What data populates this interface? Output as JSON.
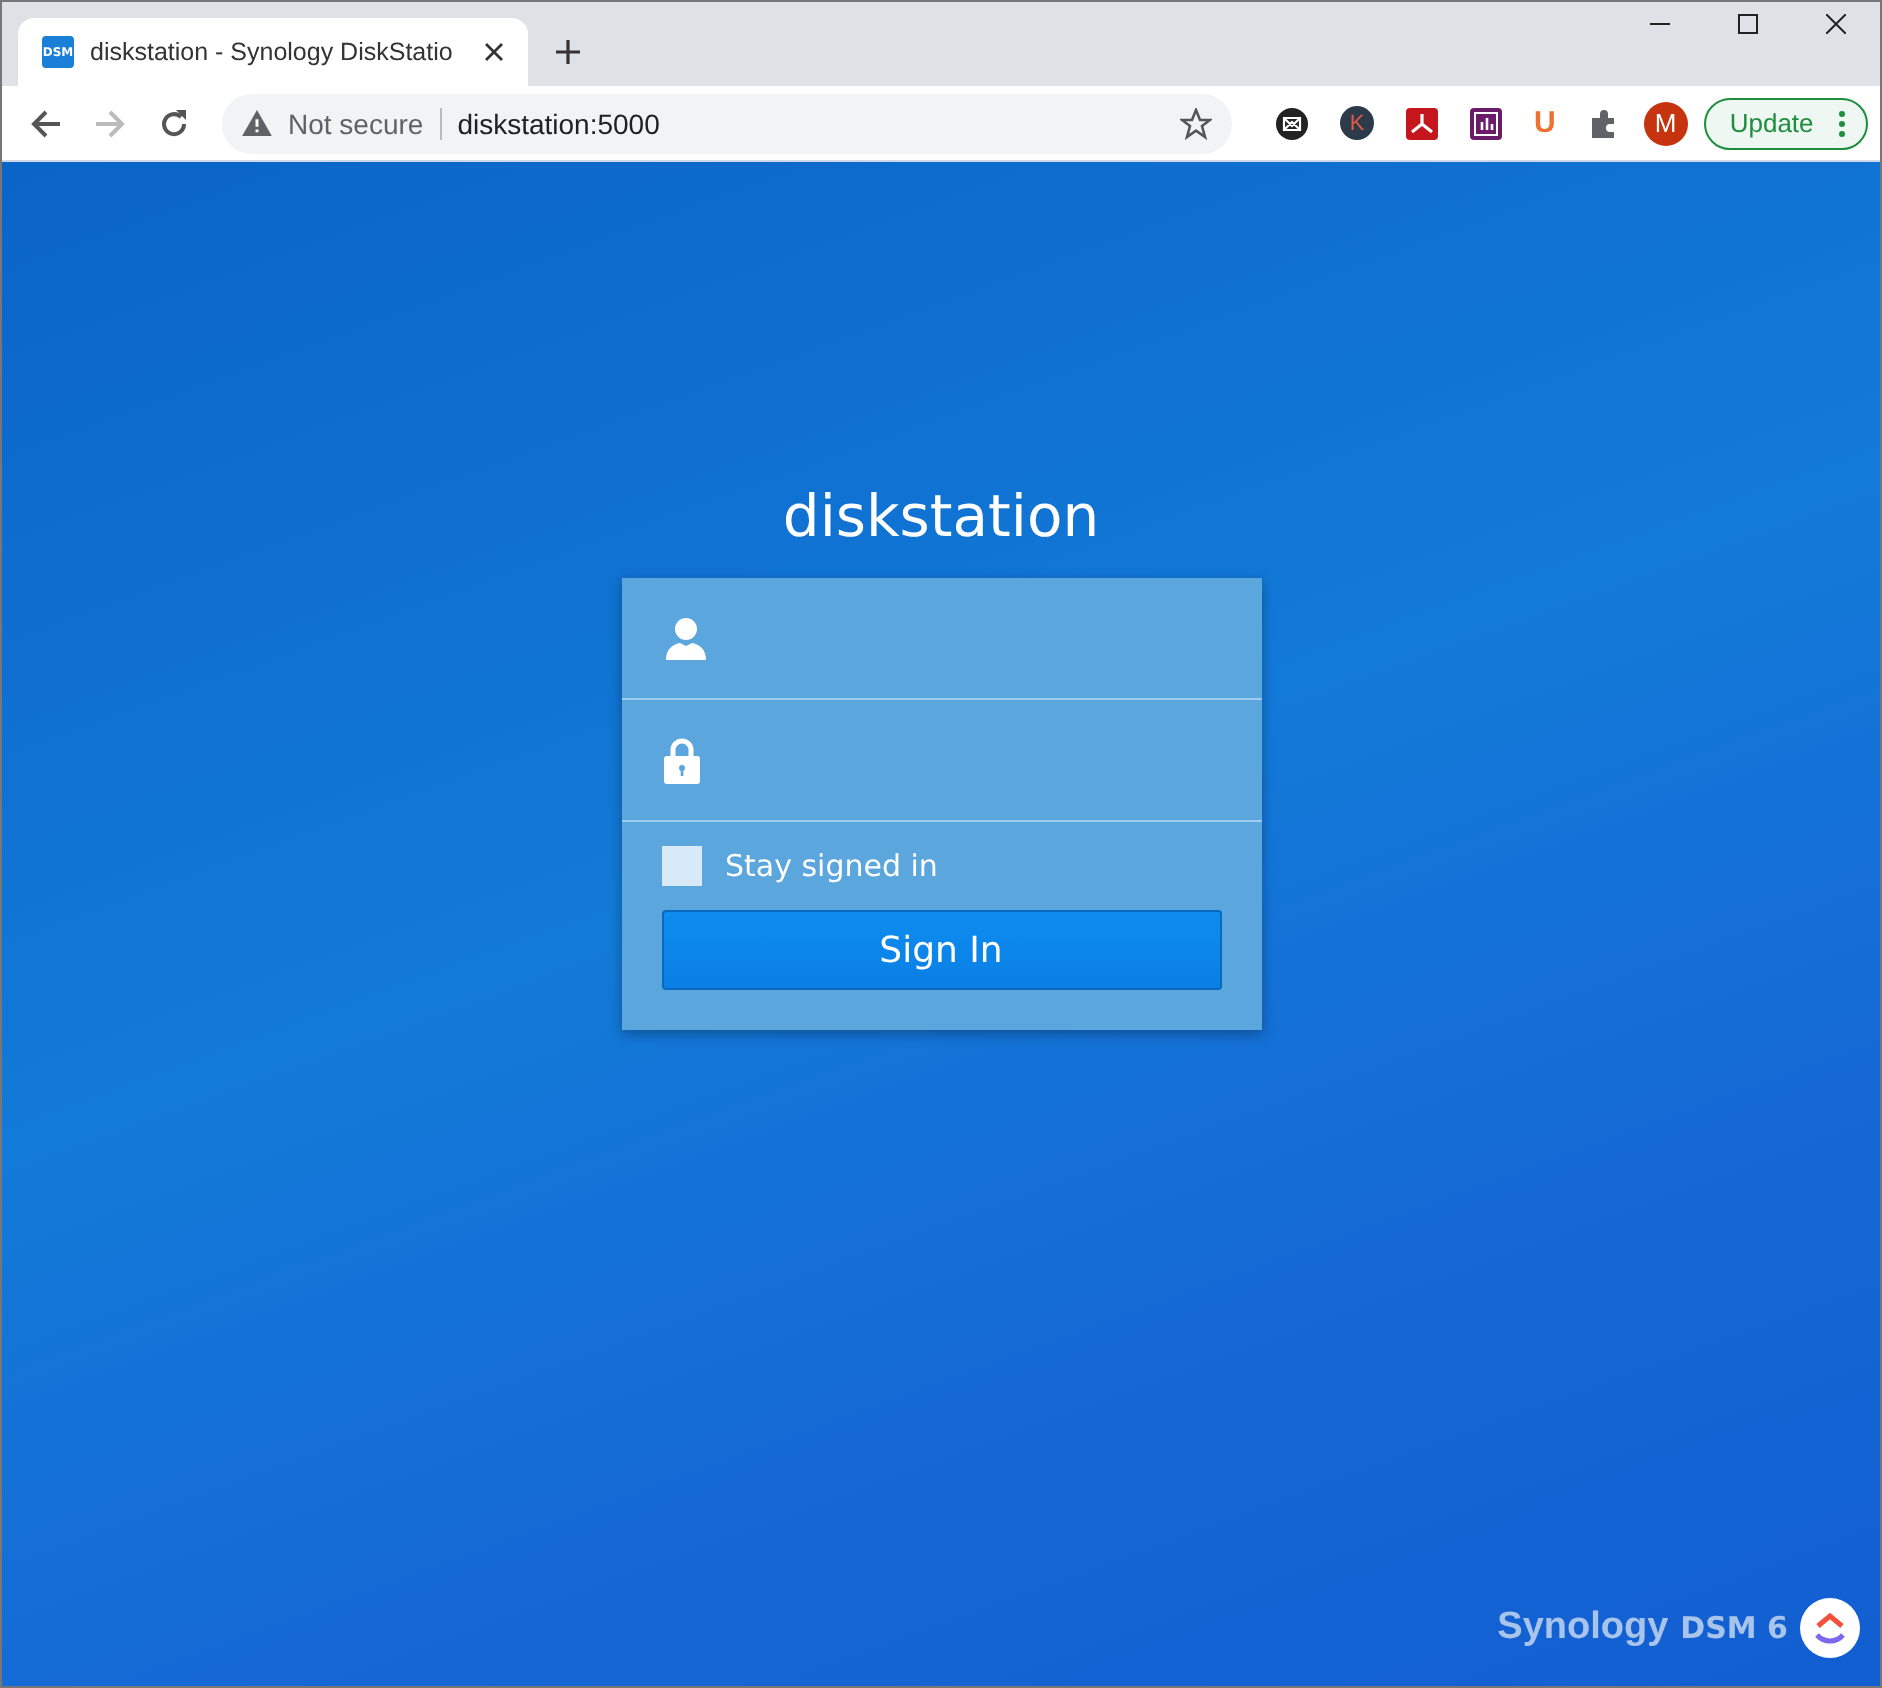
{
  "browser": {
    "tab": {
      "favicon": "DSM",
      "title": "diskstation - Synology DiskStatio"
    },
    "address_bar": {
      "security": "Not secure",
      "url": "diskstation:5000"
    },
    "extensions": [
      {
        "kind": "mail"
      },
      {
        "kind": "letter",
        "text": "K"
      },
      {
        "kind": "pdf"
      },
      {
        "kind": "chart"
      },
      {
        "kind": "u",
        "text": "U"
      },
      {
        "kind": "puzzle"
      }
    ],
    "profile": "M",
    "update_button": "Update"
  },
  "login": {
    "title": "diskstation",
    "fields": [
      {
        "kind": "user"
      },
      {
        "kind": "password"
      }
    ],
    "stay_signed_in": {
      "label": "Stay signed in",
      "checked": false
    },
    "sign_in_button": "Sign In"
  },
  "footer": {
    "brand": "Synology",
    "product": "DSM 6"
  }
}
